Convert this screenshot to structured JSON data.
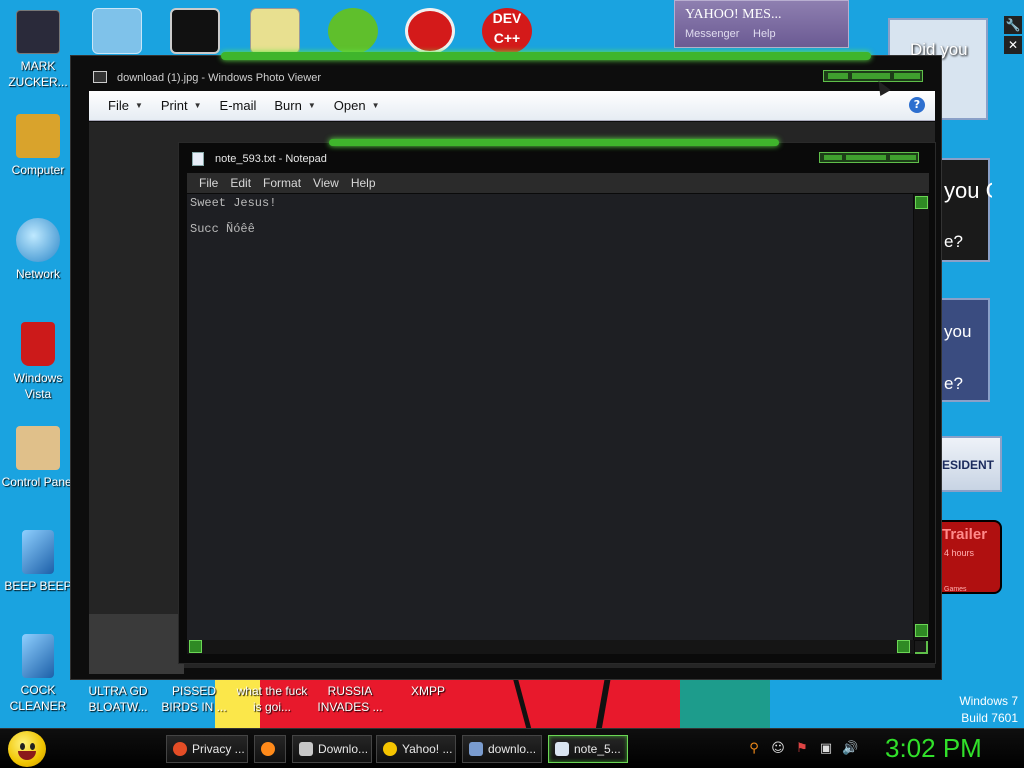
{
  "desktop": {
    "left_icons": [
      {
        "label": "MARK ZUCKER...",
        "color": "#2a2a3a"
      },
      {
        "label": "Computer",
        "color": "#d9a32c"
      },
      {
        "label": "Network",
        "color": "#3aa6e0"
      },
      {
        "label": "Windows Vista",
        "color": "#cc1a1a"
      },
      {
        "label": "Control Panel",
        "color": "#e0c08a"
      },
      {
        "label": "BEEP BEEP",
        "color": "#1c7ad0"
      },
      {
        "label": "COCK CLEANER",
        "color": "#1c7ad0"
      }
    ],
    "bottom_icons": [
      {
        "label": "ULTRA GD BLOATW..."
      },
      {
        "label": "PISSED BIRDS IN ..."
      },
      {
        "label": "what the fuck is goi..."
      },
      {
        "label": "RUSSIA INVADES ..."
      },
      {
        "label": "XMPP"
      }
    ],
    "windows_label": "Windows 7",
    "build_label": "Build 7601"
  },
  "yahoo_messenger": {
    "title": "YAHOO! MES...",
    "menu_messenger": "Messenger",
    "menu_help": "Help"
  },
  "ads": {
    "did_you": "Did you",
    "you_ca": "you CA",
    "question": "e?",
    "you2": "you",
    "question2": "e?",
    "president": "ESIDENT",
    "trailer": "Trailer",
    "hours": "4 hours",
    "games": "Games"
  },
  "photo_viewer": {
    "title": "download (1).jpg - Windows Photo Viewer",
    "menu": [
      {
        "label": "File",
        "dropdown": true
      },
      {
        "label": "Print",
        "dropdown": true
      },
      {
        "label": "E-mail",
        "dropdown": false
      },
      {
        "label": "Burn",
        "dropdown": true
      },
      {
        "label": "Open",
        "dropdown": true
      }
    ],
    "help_icon": "?"
  },
  "notepad": {
    "title": "note_593.txt - Notepad",
    "menu": [
      "File",
      "Edit",
      "Format",
      "View",
      "Help"
    ],
    "lines": [
      "Sweet Jesus!",
      "",
      "Succ Ñóêê"
    ]
  },
  "taskbar": {
    "tasks": [
      {
        "label": "Privacy ...",
        "icon_color": "#e44d26",
        "active": false
      },
      {
        "label": "",
        "icon_color": "#ff8a1a",
        "active": false
      },
      {
        "label": "Downlo...",
        "icon_color": "#c8c8c8",
        "active": false
      },
      {
        "label": "Yahoo! ...",
        "icon_color": "#f5c400",
        "active": false
      },
      {
        "label": "downlo...",
        "icon_color": "#7a9ccf",
        "active": false
      },
      {
        "label": "note_5...",
        "icon_color": "#d9e4f0",
        "active": true
      }
    ],
    "clock": "3:02 PM",
    "accent": "#31e02a"
  }
}
